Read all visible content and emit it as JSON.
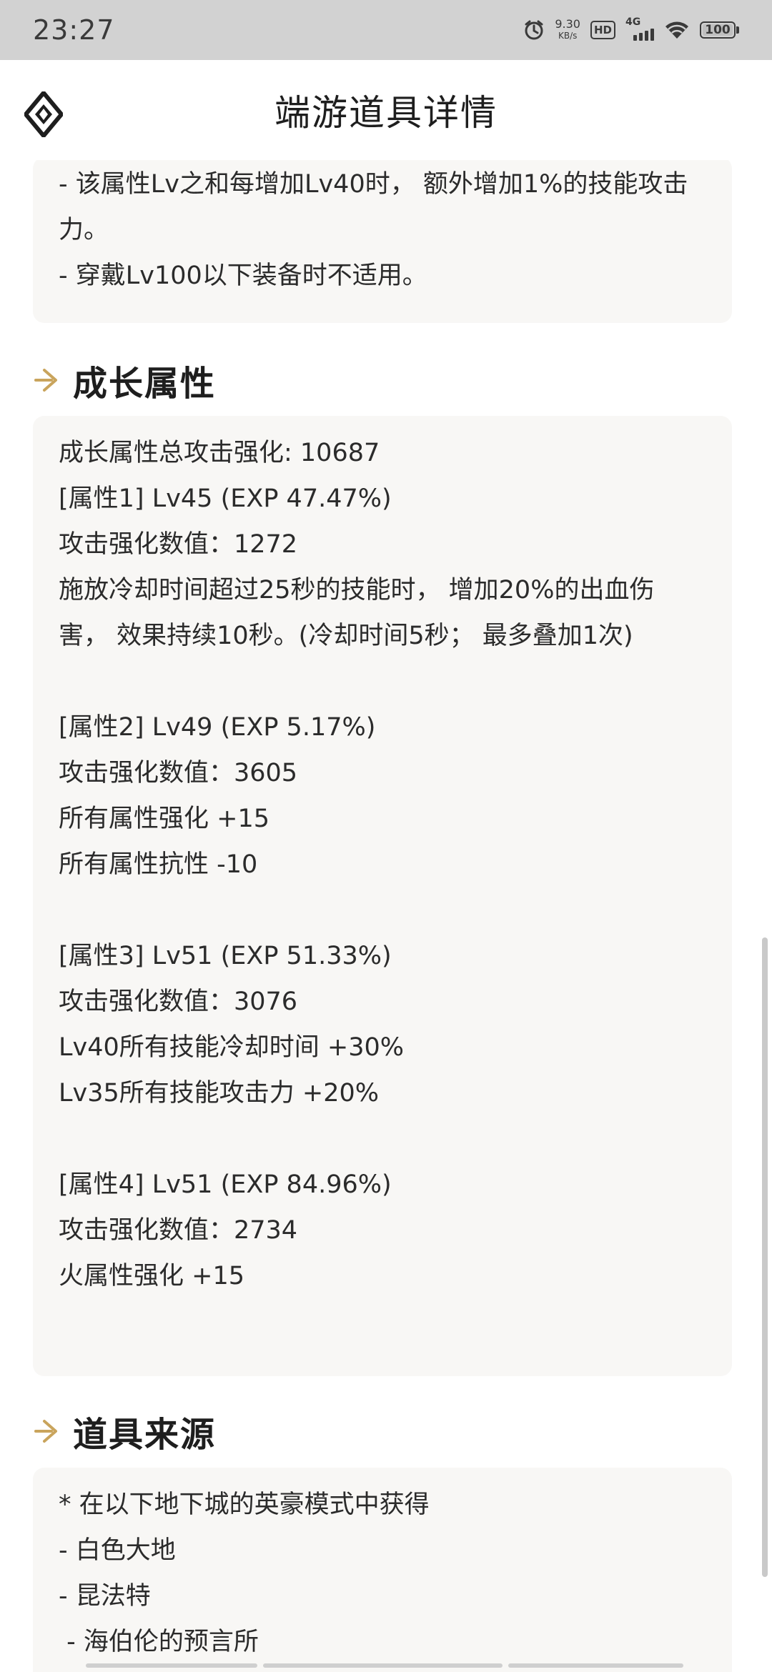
{
  "status_bar": {
    "time": "23:27",
    "speed_value": "9.30",
    "speed_unit": "KB/s",
    "hd": "HD",
    "network": "4G",
    "battery": "100"
  },
  "header": {
    "title": "端游道具详情"
  },
  "top_card": {
    "lines": [
      "- 该属性Lv之和每增加Lv40时， 额外增加1%的技能攻击",
      "力。",
      "- 穿戴Lv100以下装备时不适用。"
    ]
  },
  "growth": {
    "heading": "成长属性",
    "lines": [
      "成长属性总攻击强化: 10687",
      "[属性1] Lv45 (EXP 47.47%)",
      "攻击强化数值：1272",
      "施放冷却时间超过25秒的技能时， 增加20%的出血伤",
      "害， 效果持续10秒。(冷却时间5秒； 最多叠加1次)",
      "",
      "[属性2] Lv49 (EXP 5.17%)",
      "攻击强化数值：3605",
      "所有属性强化 +15",
      "所有属性抗性 -10",
      "",
      "[属性3] Lv51 (EXP 51.33%)",
      "攻击强化数值：3076",
      "Lv40所有技能冷却时间 +30%",
      "Lv35所有技能攻击力 +20%",
      "",
      "[属性4] Lv51 (EXP 84.96%)",
      "攻击强化数值：2734",
      "火属性强化 +15"
    ]
  },
  "source": {
    "heading": "道具来源",
    "lines": [
      "* 在以下地下城的英豪模式中获得",
      "- 白色大地",
      "- 昆法特",
      " - 海伯伦的预言所"
    ]
  },
  "colors": {
    "status_bar_bg": "#d2d2d2",
    "card_bg": "#f8f7f5",
    "accent_gold": "#c9a45c"
  }
}
